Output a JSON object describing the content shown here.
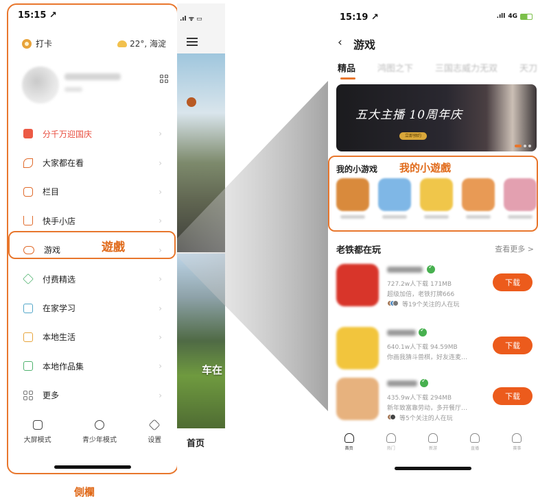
{
  "sidebar": {
    "status_time": "15:15 ↗",
    "checkin_label": "打卡",
    "weather": "22°, 海淀",
    "menu": [
      {
        "label": "分千万迎国庆",
        "icon": "red-envelope-icon"
      },
      {
        "label": "大家都在看",
        "icon": "leaf-icon"
      },
      {
        "label": "栏目",
        "icon": "tv-icon"
      },
      {
        "label": "快手小店",
        "icon": "cart-icon"
      },
      {
        "label": "游戏",
        "icon": "gamepad-icon"
      },
      {
        "label": "付费精选",
        "icon": "diamond-icon"
      },
      {
        "label": "在家学习",
        "icon": "book-icon"
      },
      {
        "label": "本地生活",
        "icon": "house-icon"
      },
      {
        "label": "本地作品集",
        "icon": "album-icon"
      },
      {
        "label": "更多",
        "icon": "grid-icon"
      }
    ],
    "modes": [
      {
        "label": "大屏模式",
        "icon": "screen-icon"
      },
      {
        "label": "青少年模式",
        "icon": "youth-icon"
      },
      {
        "label": "设置",
        "icon": "settings-icon"
      }
    ]
  },
  "annotations": {
    "games": "遊戲",
    "sidebar": "側欄",
    "mini_games": "我的小遊戲"
  },
  "feed": {
    "video_label": "车在",
    "home_tab": "首页"
  },
  "games_page": {
    "status_time": "15:19 ↗",
    "network": "4G",
    "title": "游戏",
    "tabs": [
      "精品",
      "鸿图之下",
      "三国志威力无双",
      "天刀"
    ],
    "banner_title": "五大主播 10周年庆",
    "banner_button": "立即预约",
    "mini_games_header": "我的小游戏",
    "mini_games": [
      {
        "color": "#d98a3c"
      },
      {
        "color": "#7fb7e6"
      },
      {
        "color": "#f0c64a"
      },
      {
        "color": "#e89a55"
      },
      {
        "color": "#e3a0b0"
      }
    ],
    "section_title": "老铁都在玩",
    "see_more": "查看更多 >",
    "games": [
      {
        "meta": "727.2w人下载  171MB",
        "desc": "超级加倍，老铁打牌666",
        "friends": "等19个关注的人在玩",
        "button": "下载",
        "color": "#d8352a"
      },
      {
        "meta": "640.1w人下载  94.59MB",
        "desc": "你画我猜斗兽棋，好友连麦…",
        "friends": "",
        "button": "下载",
        "color": "#f2c53d"
      },
      {
        "meta": "435.9w人下载  294MB",
        "desc": "新年致富靠劳动，多开餐厅…",
        "friends": "等5个关注的人在玩",
        "button": "下载",
        "color": "#e7b27e"
      }
    ],
    "bottom_tabs": [
      {
        "label": "首页",
        "icon": "home-icon"
      },
      {
        "label": "热门",
        "icon": "hot-icon"
      },
      {
        "label": "新游",
        "icon": "new-icon"
      },
      {
        "label": "直播",
        "icon": "live-icon"
      },
      {
        "label": "赛事",
        "icon": "trophy-icon"
      }
    ]
  },
  "colors": {
    "accent": "#e8762c",
    "download": "#ec5b1c",
    "verified": "#47b04f"
  }
}
